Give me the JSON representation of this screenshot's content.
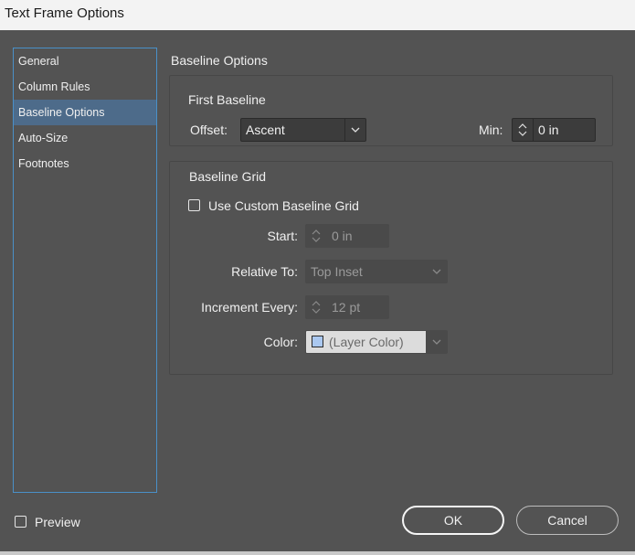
{
  "window": {
    "title": "Text Frame Options"
  },
  "sidebar": {
    "items": [
      {
        "label": "General",
        "selected": false
      },
      {
        "label": "Column Rules",
        "selected": false
      },
      {
        "label": "Baseline Options",
        "selected": true
      },
      {
        "label": "Auto-Size",
        "selected": false
      },
      {
        "label": "Footnotes",
        "selected": false
      }
    ]
  },
  "main": {
    "section_title": "Baseline Options",
    "first_baseline": {
      "group_label": "First Baseline",
      "offset_label": "Offset:",
      "offset_value": "Ascent",
      "min_label": "Min:",
      "min_value": "0 in"
    },
    "baseline_grid": {
      "group_label": "Baseline Grid",
      "use_custom_label": "Use Custom Baseline Grid",
      "use_custom_checked": false,
      "start_label": "Start:",
      "start_value": "0 in",
      "relative_to_label": "Relative To:",
      "relative_to_value": "Top Inset",
      "increment_label": "Increment Every:",
      "increment_value": "12 pt",
      "color_label": "Color:",
      "color_value": "(Layer Color)",
      "color_swatch": "#aac8f0"
    }
  },
  "footer": {
    "preview_label": "Preview",
    "preview_checked": false,
    "ok_label": "OK",
    "cancel_label": "Cancel"
  },
  "colors": {
    "background": "#535353",
    "selection": "#4d6b8a",
    "sidebar_border": "#4a90c8"
  }
}
